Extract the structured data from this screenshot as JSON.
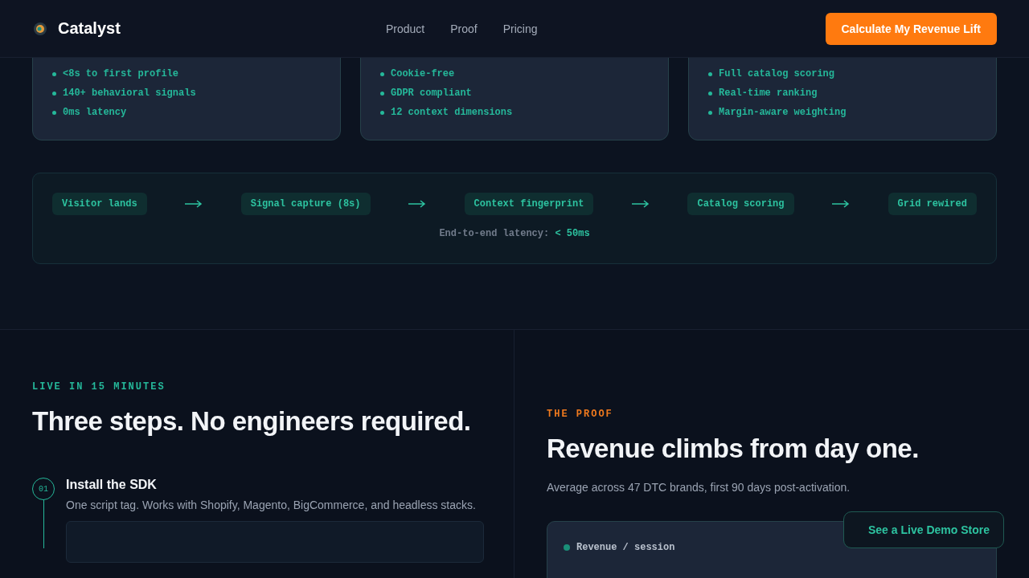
{
  "header": {
    "brand": "Catalyst",
    "nav": [
      "Product",
      "Proof",
      "Pricing"
    ],
    "cta": "Calculate My Revenue Lift"
  },
  "feature_cards": [
    {
      "bullets": [
        "<8s to first profile",
        "140+ behavioral signals",
        "0ms latency"
      ]
    },
    {
      "bullets": [
        "Cookie-free",
        "GDPR compliant",
        "12 context dimensions"
      ]
    },
    {
      "bullets": [
        "Full catalog scoring",
        "Real-time ranking",
        "Margin-aware weighting"
      ]
    }
  ],
  "pipeline": {
    "stages": [
      "Visitor lands",
      "Signal capture (8s)",
      "Context fingerprint",
      "Catalog scoring",
      "Grid rewired"
    ],
    "latency_label": "End-to-end latency:",
    "latency_value": "< 50ms"
  },
  "setup": {
    "eyebrow": "LIVE IN 15 MINUTES",
    "title": "Three steps. No engineers required.",
    "steps": [
      {
        "number": "01",
        "title": "Install the SDK",
        "description": "One script tag. Works with Shopify, Magento, BigCommerce, and headless stacks."
      }
    ]
  },
  "proof": {
    "eyebrow": "THE PROOF",
    "title": "Revenue climbs from day one.",
    "subtitle": "Average across 47 DTC brands, first 90 days post-activation.",
    "chart_card": {
      "legend": "Revenue / session"
    }
  },
  "floating_button": "See a Live Demo Store"
}
